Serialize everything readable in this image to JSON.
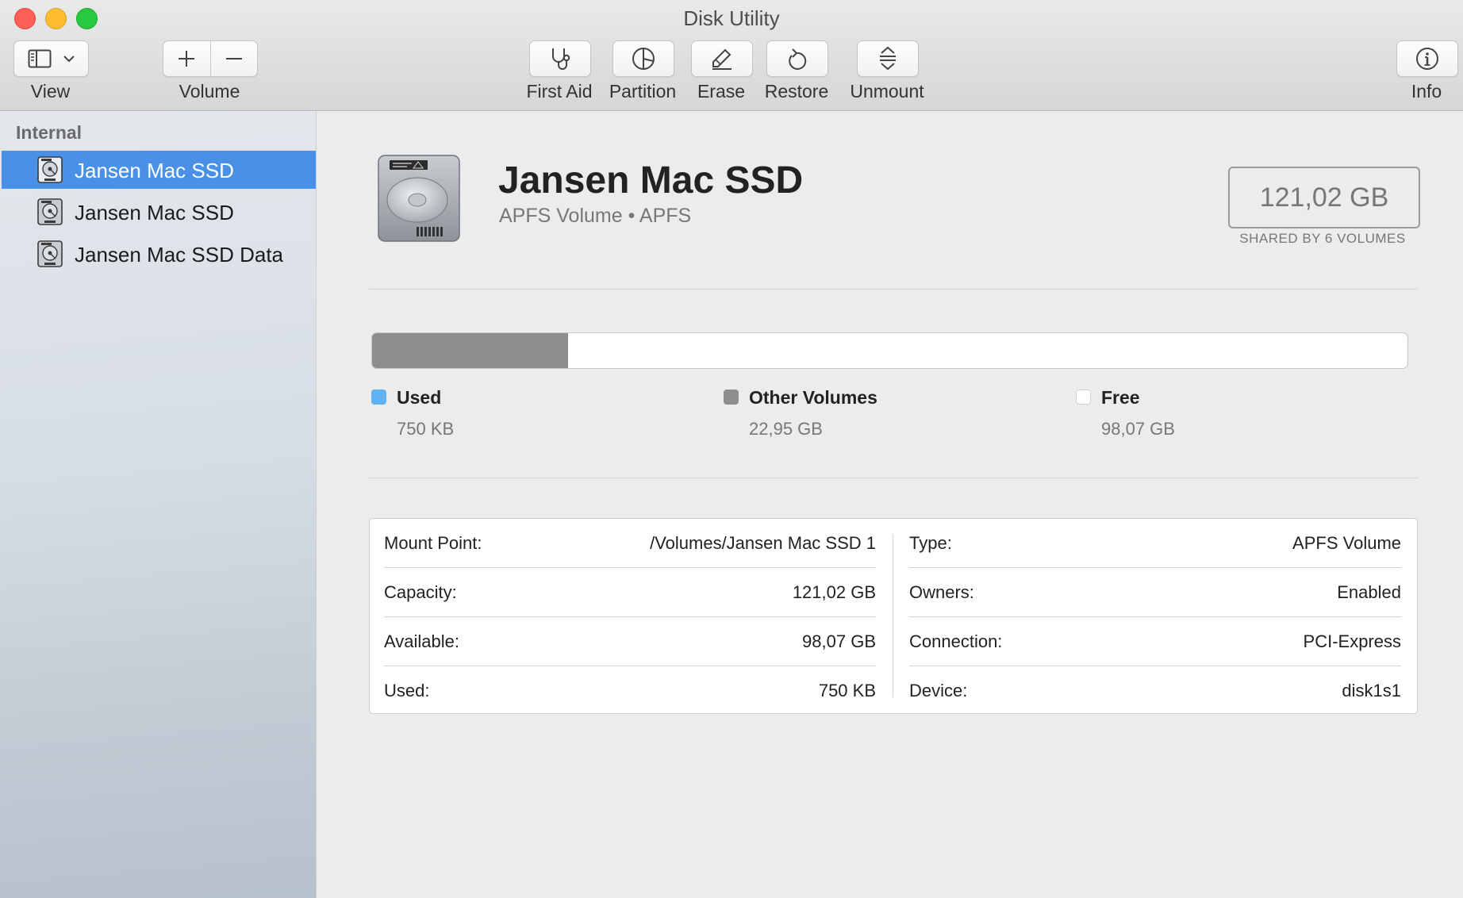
{
  "window": {
    "title": "Disk Utility"
  },
  "toolbar": {
    "view_label": "View",
    "volume_label": "Volume",
    "first_aid_label": "First Aid",
    "partition_label": "Partition",
    "erase_label": "Erase",
    "restore_label": "Restore",
    "unmount_label": "Unmount",
    "info_label": "Info"
  },
  "sidebar": {
    "section": "Internal",
    "items": [
      {
        "label": "Jansen Mac SSD",
        "icon": "hard-disk-icon",
        "selected": true
      },
      {
        "label": "Jansen Mac SSD",
        "icon": "hard-disk-icon",
        "selected": false
      },
      {
        "label": "Jansen Mac SSD Data",
        "icon": "hard-disk-icon",
        "selected": false
      }
    ]
  },
  "volume": {
    "name": "Jansen Mac SSD",
    "subtitle": "APFS Volume • APFS",
    "capacity": "121,02 GB",
    "capacity_caption": "SHARED BY 6 VOLUMES"
  },
  "usage": {
    "used_fraction": 6.2e-06,
    "other_fraction": 0.1896,
    "legend": [
      {
        "name": "Used",
        "value": "750 KB",
        "color": "#5eb2f3"
      },
      {
        "name": "Other Volumes",
        "value": "22,95 GB",
        "color": "#8e8e8e"
      },
      {
        "name": "Free",
        "value": "98,07 GB",
        "color": "#ffffff"
      }
    ]
  },
  "info": {
    "left": [
      {
        "key": "Mount Point:",
        "value": "/Volumes/Jansen Mac SSD 1"
      },
      {
        "key": "Capacity:",
        "value": "121,02 GB"
      },
      {
        "key": "Available:",
        "value": "98,07 GB"
      },
      {
        "key": "Used:",
        "value": "750 KB"
      }
    ],
    "right": [
      {
        "key": "Type:",
        "value": "APFS Volume"
      },
      {
        "key": "Owners:",
        "value": "Enabled"
      },
      {
        "key": "Connection:",
        "value": "PCI-Express"
      },
      {
        "key": "Device:",
        "value": "disk1s1"
      }
    ]
  },
  "colors": {
    "selection": "#4a90e7",
    "used": "#5eb2f3",
    "other": "#8e8e8e"
  }
}
